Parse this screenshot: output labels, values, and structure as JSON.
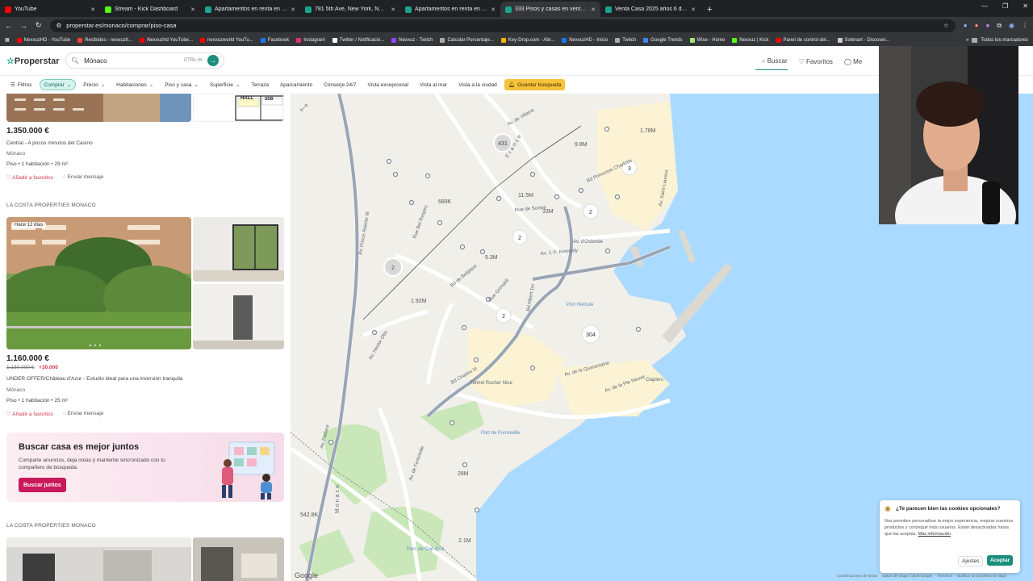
{
  "browser": {
    "tabs": [
      {
        "title": "YouTube",
        "color": "#ff0000"
      },
      {
        "title": "Stream - Kick Dashboard",
        "color": "#53fc18"
      },
      {
        "title": "Apartamentos en renta en New...",
        "color": "#1aa38f"
      },
      {
        "title": "781 5th Ave, New York, NY 100...",
        "color": "#1aa38f"
      },
      {
        "title": "Apartamentos en renta en Las...",
        "color": "#1aa38f"
      },
      {
        "title": "333 Pisos y casas en venta en M...",
        "color": "#1aa38f",
        "active": true
      },
      {
        "title": "Venta Casa 2025 años 6 dormi...",
        "color": "#1aa38f"
      }
    ],
    "new_tab": "+",
    "url": "properstar.es/monaco/comprar/piso-casa",
    "bookmarks": [
      {
        "label": "NexxuzHD - YouTube",
        "color": "#ff0000"
      },
      {
        "label": "Recibidos - nexxuzh...",
        "color": "#ea4335"
      },
      {
        "label": "Nexxuzhd YouTube...",
        "color": "#ff0000"
      },
      {
        "label": "nexxuzworld YouTu...",
        "color": "#ff0000"
      },
      {
        "label": "Facebook",
        "color": "#1877f2"
      },
      {
        "label": "Instagram",
        "color": "#e1306c"
      },
      {
        "label": "Twitter / Notificacio...",
        "color": "#ffffff"
      },
      {
        "label": "Nexxuz - Twitch",
        "color": "#9146ff"
      },
      {
        "label": "Calcular Porcentaje...",
        "color": "#aaaaaa"
      },
      {
        "label": "Key-Drop.com - Abr...",
        "color": "#f4b400"
      },
      {
        "label": "NexxuzHD - Inicio",
        "color": "#1877f2"
      },
      {
        "label": "Twitch",
        "color": "#9146ff"
      },
      {
        "label": "Google Trends",
        "color": "#4285f4"
      },
      {
        "label": "Wise - Home",
        "color": "#9fe870"
      },
      {
        "label": "Nexxuz | Kick",
        "color": "#53fc18"
      },
      {
        "label": "Panel de control del...",
        "color": "#ff0000"
      },
      {
        "label": "Solenart - Discover...",
        "color": "#cccccc"
      }
    ],
    "all_bookmarks": "Todos los marcadores"
  },
  "site": {
    "logo": "Properstar",
    "search_value": "Mónaco",
    "search_shortcut": "CTRL+K",
    "nav": {
      "search": "Buscar",
      "favorites": "Favoritos",
      "more": "Me"
    }
  },
  "filters": {
    "items": [
      "Filtros",
      "Comprar",
      "Precio",
      "Habitaciones",
      "Piso y casa",
      "Superficie",
      "Terraza",
      "Aparcamiento",
      "Conserje 24/7",
      "Vista excepcional",
      "Vista al mar",
      "Vista a la ciudad"
    ],
    "save": "Guardar búsqueda"
  },
  "listings": [
    {
      "price": "1.350.000 €",
      "title": "Central - A pocos minutos del Casino",
      "location": "Mónaco",
      "details": "Piso • 1 habitación • 29 m²",
      "favorite": "Añadir a favoritos",
      "message": "Enviar mensaje",
      "photo_sign_1": "HALL",
      "photo_sign_2": "SDB"
    },
    {
      "agency": "LA COSTA PROPERTIES MONACO",
      "badge": "Hace 12 días",
      "price": "1.160.000 €",
      "old_price": "1.130.000 €",
      "delta": "+30.000",
      "title": "UNDER OFFER/Château d'Azur - Estudio ideal para una inversión tranquila",
      "location": "Mónaco",
      "details": "Piso • 1 habitación • 25 m²",
      "favorite": "Añadir a favoritos",
      "message": "Enviar mensaje"
    },
    {
      "agency": "LA COSTA PROPERTIES MONACO"
    }
  ],
  "banner": {
    "title": "Buscar casa es mejor juntos",
    "text": "Comparte anuncios, deja notas y mantente sincronizado con tu compañero de búsqueda.",
    "button": "Buscar juntos"
  },
  "map": {
    "clusters": [
      "431",
      "3",
      "2",
      "2",
      "2",
      "2",
      "304"
    ],
    "prices": [
      "1.78M",
      "9.8M",
      "11.5M",
      "33M",
      "689K",
      "5.3M",
      "1.92M",
      "28M",
      "542.8K",
      "2.1M"
    ],
    "streets": [
      "Av. Prince Rainier III",
      "Av. de Villaine",
      "Bd Princesse Charlotte",
      "Rue de Suisse",
      "Av. d'Ostende",
      "Av. J.-F. Kennedy",
      "Bd de Belgique",
      "Rue Grimaldi",
      "Bd Albert 1er",
      "Bd Charles III",
      "Tunnel Rocher Nice",
      "Av. de la Quarantaine",
      "Av. de la Pte Neuve",
      "Av. de Fontvieille",
      "Monaco",
      "France",
      "Port Hercule",
      "Port de Fontvieille",
      "Parc de Cap d'Ail",
      "Av. Pasteur",
      "Av. Hector Otto",
      "Rue Bel Respiro",
      "Av. Saint-Laurent",
      "Clapiers"
    ],
    "google": "Google",
    "footer": [
      "Combinaciones de teclas",
      "Datos del mapa ©2026 Google",
      "Términos",
      "Notificar un problema de Maps"
    ]
  },
  "cookie": {
    "title": "¿Te parecen bien las cookies opcionales?",
    "text": "Nos permiten personalizar la mejor experiencia, mejorar nuestros productos y conseguir más usuarios. Están desactivadas hasta que las aceptas.",
    "link": "Más información",
    "settings": "Ajustes",
    "accept": "Aceptar"
  }
}
